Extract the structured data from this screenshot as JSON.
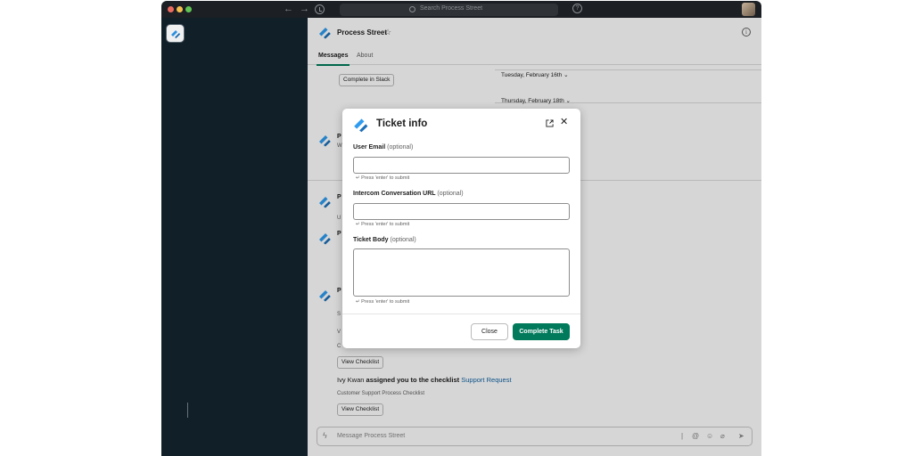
{
  "titlebar": {
    "search_placeholder": "Search Process Street",
    "help_label": "?"
  },
  "channel": {
    "name": "Process Street",
    "star": "☆",
    "info": "i",
    "tabs": [
      "Messages",
      "About"
    ]
  },
  "feed": {
    "complete_in_slack": "Complete in Slack",
    "dates": [
      "Tuesday, February 16th",
      "Thursday, February 18th"
    ],
    "date_chevron": "⌄",
    "view_checklist": "View Checklist",
    "assignment": {
      "user": "Ivy Kwan",
      "action": "assigned you to the checklist",
      "checklist": "Support Request"
    },
    "checklist_subtitle": "Customer Support Process Checklist",
    "fragments": {
      "name": "P",
      "sub_1": "W",
      "sub_2": "U",
      "sub_3": "S",
      "sub_4": "V",
      "sub_5": "C"
    }
  },
  "composer": {
    "placeholder": "Message Process Street"
  },
  "modal": {
    "title": "Ticket info",
    "fields": [
      {
        "label": "User Email",
        "optional": "(optional)",
        "value": "",
        "hint": "↵ Press 'enter' to submit"
      },
      {
        "label": "Intercom Conversation URL",
        "optional": "(optional)",
        "value": "",
        "hint": "↵ Press 'enter' to submit"
      },
      {
        "label": "Ticket Body",
        "optional": "(optional)",
        "value": "",
        "hint": "↵ Press 'enter' to submit"
      }
    ],
    "close_label": "Close",
    "complete_label": "Complete Task"
  },
  "colors": {
    "sidebar": "#12212b",
    "primary_button": "#007a5a",
    "brand_blue": "#2f9cf0",
    "link": "#1264a3"
  }
}
